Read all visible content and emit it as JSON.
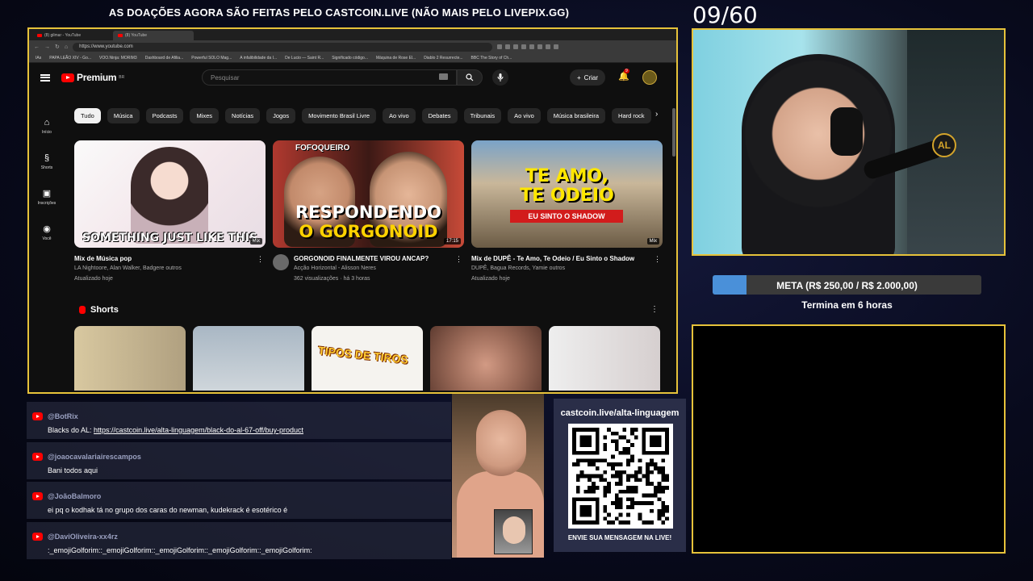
{
  "banner": "AS DOAÇÕES AGORA SÃO FEITAS PELO CASTCOIN.LIVE (NÃO MAIS PELO LIVEPIX.GG)",
  "counter": "09/60",
  "browser": {
    "tabs": [
      "(8) gilmar - YouTube",
      "(8) YouTube"
    ],
    "url": "https://www.youtube.com",
    "bookmarks": [
      "IAs",
      "PAPA LEÃO XIV - Go...",
      "VOO.Ninja: MORIM3",
      "Dashboard de Afilia...",
      "Powerful SOLO Mag...",
      "A infalibilidade da I...",
      "De Lucio — Saint R...",
      "Significado código...",
      "Máquina de Rose El...",
      "Diablo 2 Resurrecte...",
      "BBC The Story of Ch..."
    ]
  },
  "youtube": {
    "logo_text": "Premium",
    "logo_badge": "BR",
    "search_placeholder": "Pesquisar",
    "create_label": "Criar",
    "notif_count": "9",
    "sidebar": [
      {
        "icon": "home-icon",
        "glyph": "⌂",
        "label": "Início"
      },
      {
        "icon": "shorts-icon",
        "glyph": "§",
        "label": "Shorts"
      },
      {
        "icon": "subscriptions-icon",
        "glyph": "▣",
        "label": "Inscrições"
      },
      {
        "icon": "you-icon",
        "glyph": "◉",
        "label": "Você"
      }
    ],
    "chips": [
      "Tudo",
      "Música",
      "Podcasts",
      "Mixes",
      "Notícias",
      "Jogos",
      "Movimento Brasil Livre",
      "Ao vivo",
      "Debates",
      "Tribunais",
      "Ao vivo",
      "Música brasileira",
      "Hard rock"
    ],
    "videos": [
      {
        "title": "Mix de Música pop",
        "line1": "LA Nightoore, Alan Walker, Badgere outros",
        "line2": "Atualizado hoje",
        "badge": "Mix",
        "caption": "SOMETHING JUST LIKE THIS"
      },
      {
        "title": "GORGONOID FINALMENTE VIROU ANCAP?",
        "line1": "Acção Horizontal - Alisson Neres",
        "line2": "362 visualizações · há 3 horas",
        "badge": "17:15",
        "caption_top": "FOFOQUEIRO",
        "caption_l1": "RESPONDENDO",
        "caption_l2": "O GORGONOID"
      },
      {
        "title": "Mix de DUPÊ - Te Amo, Te Odeio / Eu Sinto o Shadow",
        "line1": "DUPÊ, Bagua Records, Yamie outros",
        "line2": "Atualizado hoje",
        "badge": "Mix",
        "caption_l1": "TE AMO,",
        "caption_l2": "TE ODEIO",
        "caption_band": "EU SINTO O SHADOW"
      }
    ],
    "shorts_title": "Shorts",
    "shorts": [
      {
        "caption": ""
      },
      {
        "caption": ""
      },
      {
        "caption": "TIPOS DE TIROS"
      },
      {
        "caption": ""
      },
      {
        "caption": ""
      }
    ]
  },
  "goal": {
    "label": "META (R$ 250,00 / R$ 2.000,00)",
    "progress": 0.125,
    "ends": "Termina em 6 horas"
  },
  "cam_logo": "AL",
  "chat": [
    {
      "user": "@BotRix",
      "text": "Blacks do AL: ",
      "link": "https://castcoin.live/alta-linguagem/black-do-al-67-off/buy-product"
    },
    {
      "user": "@joaocavalariairescampos",
      "text": "Bani todos aqui",
      "link": ""
    },
    {
      "user": "@JoãoBalmoro",
      "text": "ei pq o kodhak tá no grupo dos caras do newman, kudekrack é esotérico é",
      "link": ""
    },
    {
      "user": "@DaviOliveira-xx4rz",
      "text": ":_emojiGolforim::_emojiGolforim::_emojiGolforim::_emojiGolforim::_emojiGolforim:",
      "link": ""
    }
  ],
  "qr": {
    "url": "castcoin.live/alta-linguagem",
    "cta": "ENVIE SUA MENSAGEM NA LIVE!"
  },
  "colors": {
    "frame": "#e6c23a",
    "youtube_red": "#ff0000",
    "goal_fill": "#4a90d9"
  }
}
